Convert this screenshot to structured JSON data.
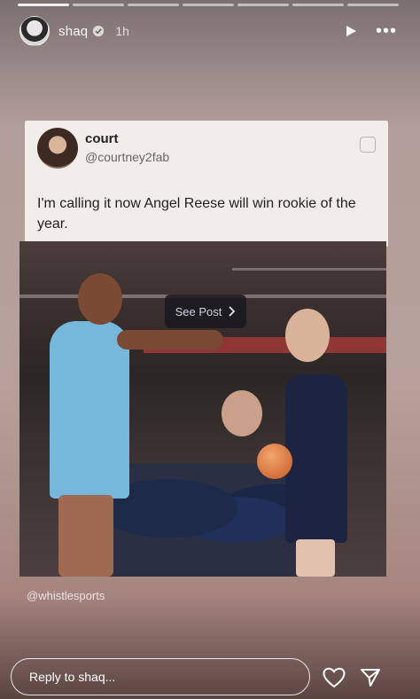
{
  "story": {
    "progress_segments": 7,
    "active_segment": 1
  },
  "header": {
    "username": "shaq",
    "time": "1h",
    "more_icon": "more-horizontal-icon",
    "play_icon": "play-icon",
    "verified_icon": "verified-badge-icon"
  },
  "card": {
    "name": "court",
    "handle": "@courtney2fab",
    "text": "I'm calling it now Angel Reese will win rookie of the year."
  },
  "photo": {
    "see_post_label": "See Post"
  },
  "credit": "@whistlesports",
  "footer": {
    "reply_placeholder": "Reply to shaq...",
    "heart_icon": "heart-icon",
    "send_icon": "send-icon"
  },
  "colors": {
    "background_top": "#7b6f70",
    "background_mid": "#b7a09b",
    "card": "#f1ede9",
    "see_post_bg": "#19191e"
  }
}
